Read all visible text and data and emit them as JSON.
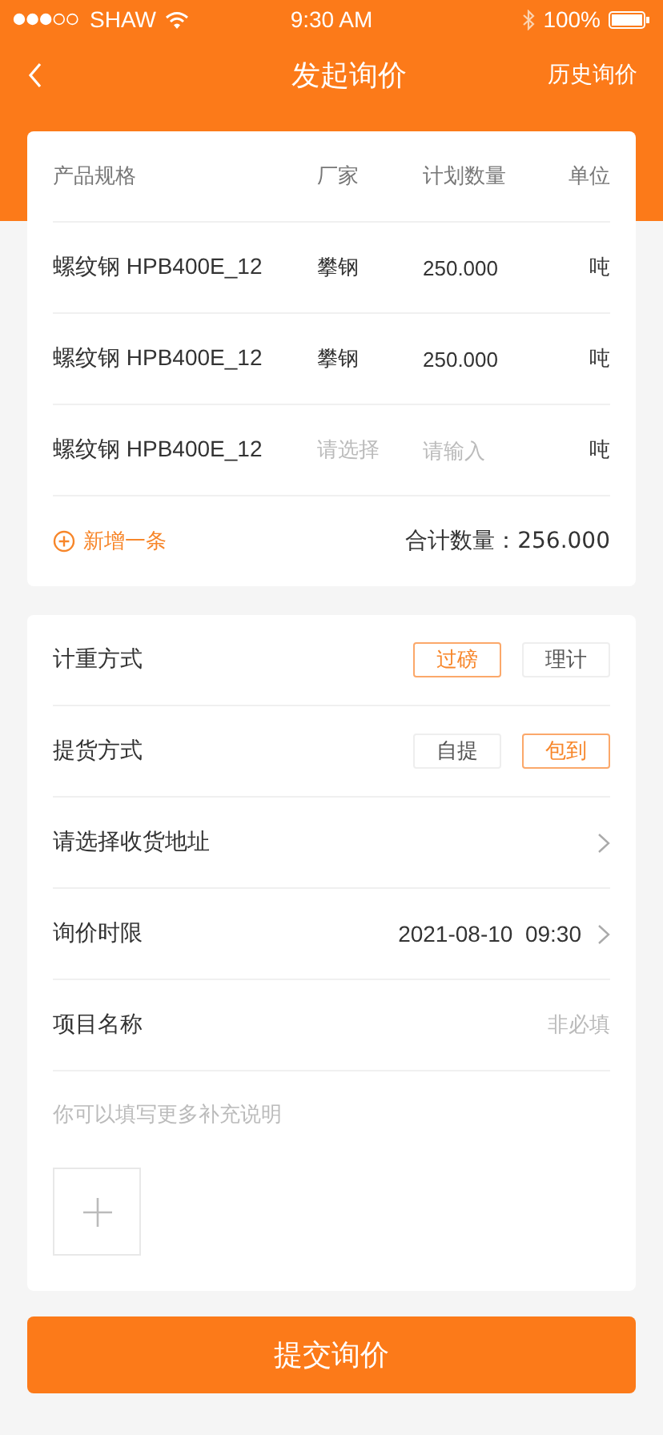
{
  "status_bar": {
    "carrier": "SHAW",
    "time": "9:30 AM",
    "battery": "100%"
  },
  "nav": {
    "title": "发起询价",
    "action": "历史询价"
  },
  "table": {
    "columns": [
      "产品规格",
      "厂家",
      "计划数量",
      "单位"
    ],
    "rows": [
      {
        "spec": "螺纹钢 HPB400E_12",
        "maker": "攀钢",
        "quantity": "250.000",
        "unit": "吨"
      },
      {
        "spec": "螺纹钢 HPB400E_12",
        "maker": "攀钢",
        "quantity": "250.000",
        "unit": "吨"
      },
      {
        "spec": "螺纹钢 HPB400E_12",
        "maker_placeholder": "请选择",
        "quantity_placeholder": "请输入",
        "unit": "吨"
      }
    ],
    "add_label": "新增一条",
    "total": "合计数量：256.000"
  },
  "form": [
    {
      "kind": "options",
      "label": "计重方式",
      "options": [
        {
          "label": "过磅",
          "selected": true
        },
        {
          "label": "理计",
          "selected": false
        }
      ]
    },
    {
      "kind": "options",
      "label": "提货方式",
      "options": [
        {
          "label": "自提",
          "selected": false
        },
        {
          "label": "包到",
          "selected": true
        }
      ]
    },
    {
      "kind": "link",
      "label": "请选择收货地址"
    },
    {
      "kind": "link",
      "label": "询价时限",
      "value": "2021-08-10  09:30"
    },
    {
      "kind": "input",
      "label": "项目名称",
      "placeholder": "非必填"
    }
  ],
  "remarks": {
    "placeholder": "你可以填写更多补充说明"
  },
  "submit": "提交询价"
}
